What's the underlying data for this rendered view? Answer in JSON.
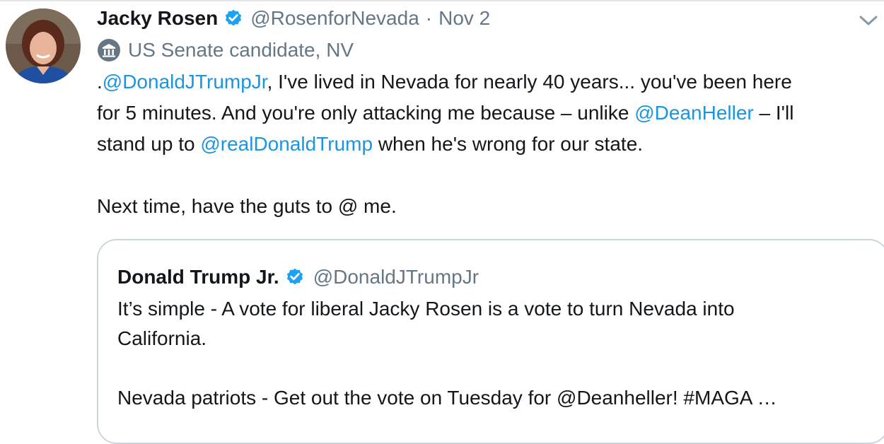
{
  "tweet": {
    "author": {
      "display_name": "Jacky Rosen",
      "handle": "@RosenforNevada",
      "verified": true
    },
    "separator": "·",
    "date": "Nov 2",
    "label": {
      "icon": "government-building-icon",
      "text": "US Senate candidate, NV"
    },
    "text_lines": [
      [
        {
          "text": ".",
          "type": "text"
        },
        {
          "text": "@DonaldJTrumpJr",
          "type": "mention"
        },
        {
          "text": ", I've lived in Nevada for nearly 40 years... you've been here",
          "type": "text"
        }
      ],
      [
        {
          "text": "for 5 minutes. And you're only attacking me because – unlike ",
          "type": "text"
        },
        {
          "text": "@DeanHeller",
          "type": "mention"
        },
        {
          "text": " – I'll",
          "type": "text"
        }
      ],
      [
        {
          "text": "stand up to ",
          "type": "text"
        },
        {
          "text": "@realDonaldTrump",
          "type": "mention"
        },
        {
          "text": " when he's wrong for our state.",
          "type": "text"
        }
      ],
      [],
      [
        {
          "text": "Next time, have the guts to @ me.",
          "type": "text"
        }
      ]
    ]
  },
  "quoted_tweet": {
    "display_name": "Donald Trump Jr.",
    "handle": "@DonaldJTrumpJr",
    "verified": true,
    "text_lines": [
      "It’s simple - A vote for liberal Jacky Rosen is a vote to turn Nevada into",
      "California.",
      "",
      "Nevada patriots - Get out the vote on Tuesday for @Deanheller! #MAGA …"
    ]
  },
  "colors": {
    "text": "#14171a",
    "secondary": "#657786",
    "link": "#1b95e0",
    "verified": "#1da1f2",
    "border": "#ccd6dd"
  }
}
